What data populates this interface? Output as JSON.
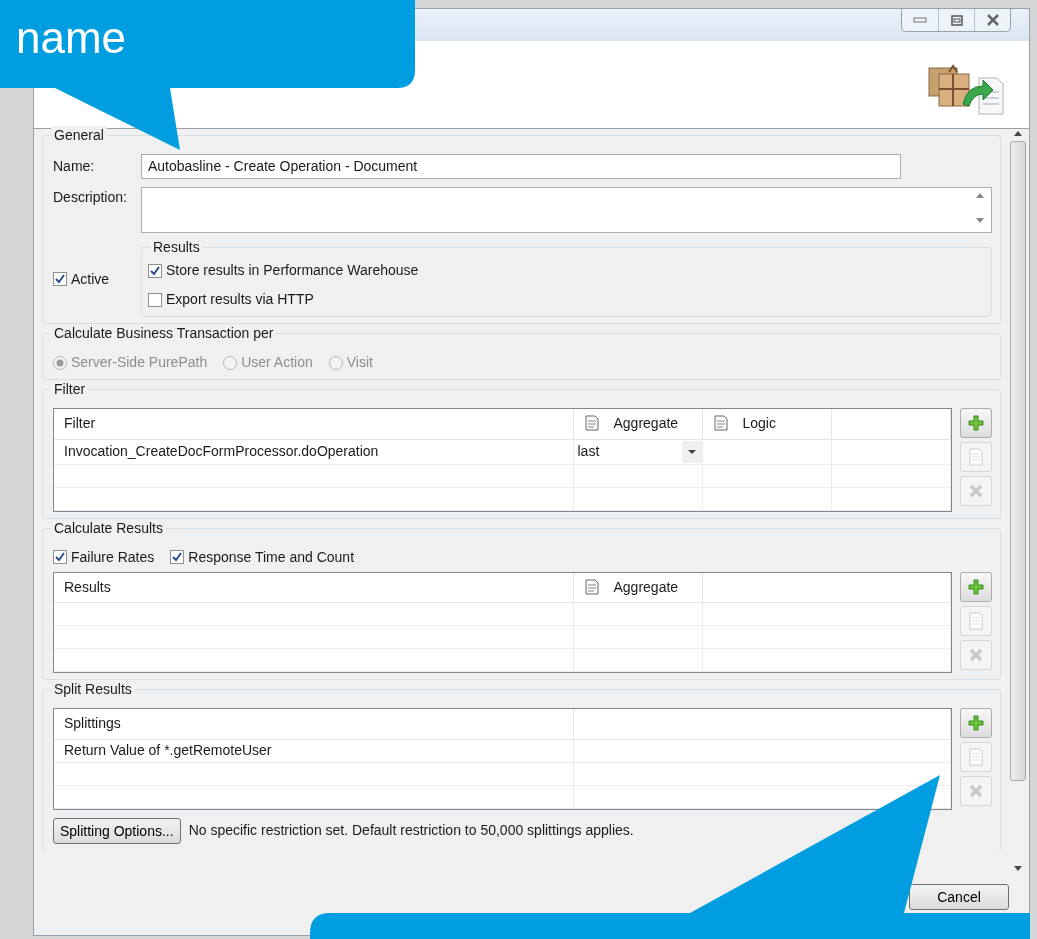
{
  "callout_top": {
    "text": "name"
  },
  "general": {
    "legend": "General",
    "name_label": "Name:",
    "name_value": "Autobasline - Create Operation - Document",
    "description_label": "Description:",
    "active": {
      "label": "Active",
      "checked": true
    },
    "results": {
      "legend": "Results",
      "options": [
        {
          "label": "Store results in Performance Warehouse",
          "checked": true
        },
        {
          "label": "Export results via HTTP",
          "checked": false
        }
      ]
    }
  },
  "calculate_per": {
    "legend": "Calculate Business Transaction per",
    "disabled": true,
    "options": [
      {
        "label": "Server-Side PurePath",
        "selected": true
      },
      {
        "label": "User Action",
        "selected": false
      },
      {
        "label": "Visit",
        "selected": false
      }
    ]
  },
  "filter": {
    "legend": "Filter",
    "table": {
      "columns": [
        {
          "label": "Filter",
          "has_icon": false
        },
        {
          "label": "Aggregate",
          "has_icon": true
        },
        {
          "label": "Logic",
          "has_icon": true
        }
      ],
      "rows": [
        {
          "cells": [
            {
              "kind": "text",
              "text": "Invocation_CreateDocFormProcessor.doOperation"
            },
            {
              "kind": "dropdown",
              "text": "last"
            }
          ]
        }
      ],
      "buttons": [
        {
          "kind": "add",
          "disabled": false
        },
        {
          "kind": "edit",
          "disabled": true
        },
        {
          "kind": "delete",
          "disabled": true
        }
      ]
    }
  },
  "calculate_results": {
    "legend": "Calculate Results",
    "checks": [
      {
        "label": "Failure Rates",
        "checked": true
      },
      {
        "label": "Response Time and Count",
        "checked": true
      }
    ],
    "table": {
      "columns": [
        {
          "label": "Results",
          "has_icon": false
        },
        {
          "label": "Aggregate",
          "has_icon": true
        }
      ],
      "buttons": [
        {
          "kind": "add",
          "disabled": false
        },
        {
          "kind": "edit",
          "disabled": true
        },
        {
          "kind": "delete",
          "disabled": true
        }
      ]
    }
  },
  "split_results": {
    "legend": "Split Results",
    "table": {
      "columns": [
        {
          "label": "Splittings",
          "has_icon": false
        }
      ],
      "rows": [
        {
          "cells": [
            {
              "kind": "text",
              "text": "Return Value of *.getRemoteUser"
            }
          ]
        }
      ],
      "buttons": [
        {
          "kind": "add",
          "disabled": false
        },
        {
          "kind": "edit",
          "disabled": true
        },
        {
          "kind": "delete",
          "disabled": true
        }
      ]
    },
    "options_button": "Splitting Options...",
    "note": "No specific restriction set. Default restriction to 50,000 splittings applies."
  },
  "footer": {
    "cancel": "Cancel"
  }
}
